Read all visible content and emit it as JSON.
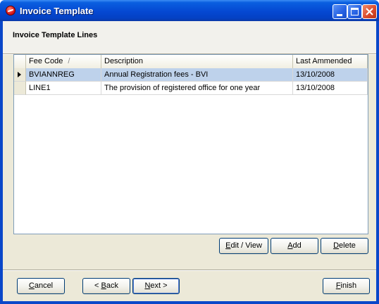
{
  "window": {
    "title": "Invoice Template"
  },
  "section": {
    "title": "Invoice Template Lines"
  },
  "table": {
    "columns": [
      "Fee Code",
      "Description",
      "Last Ammended"
    ],
    "sort_indicator": "/",
    "rows": [
      {
        "fee_code": "BVIANNREG",
        "description": "Annual Registration fees - BVI",
        "last_ammended": "13/10/2008",
        "selected": true
      },
      {
        "fee_code": "LINE1",
        "description": "The provision of registered office for one year",
        "last_ammended": "13/10/2008",
        "selected": false
      }
    ]
  },
  "grid_buttons": {
    "edit_view": {
      "pre": "",
      "key": "E",
      "post": "dit / View"
    },
    "add": {
      "pre": "",
      "key": "A",
      "post": "dd"
    },
    "delete": {
      "pre": "",
      "key": "D",
      "post": "elete"
    }
  },
  "nav_buttons": {
    "cancel": {
      "pre": "",
      "key": "C",
      "post": "ancel"
    },
    "back": {
      "pre": "< ",
      "key": "B",
      "post": "ack"
    },
    "next": {
      "pre": "",
      "key": "N",
      "post": "ext >"
    },
    "finish": {
      "pre": "",
      "key": "F",
      "post": "inish"
    }
  },
  "colors": {
    "titlebar": "#0548d2",
    "selection": "#bed2eb",
    "dialog_bg": "#ece9d8"
  }
}
